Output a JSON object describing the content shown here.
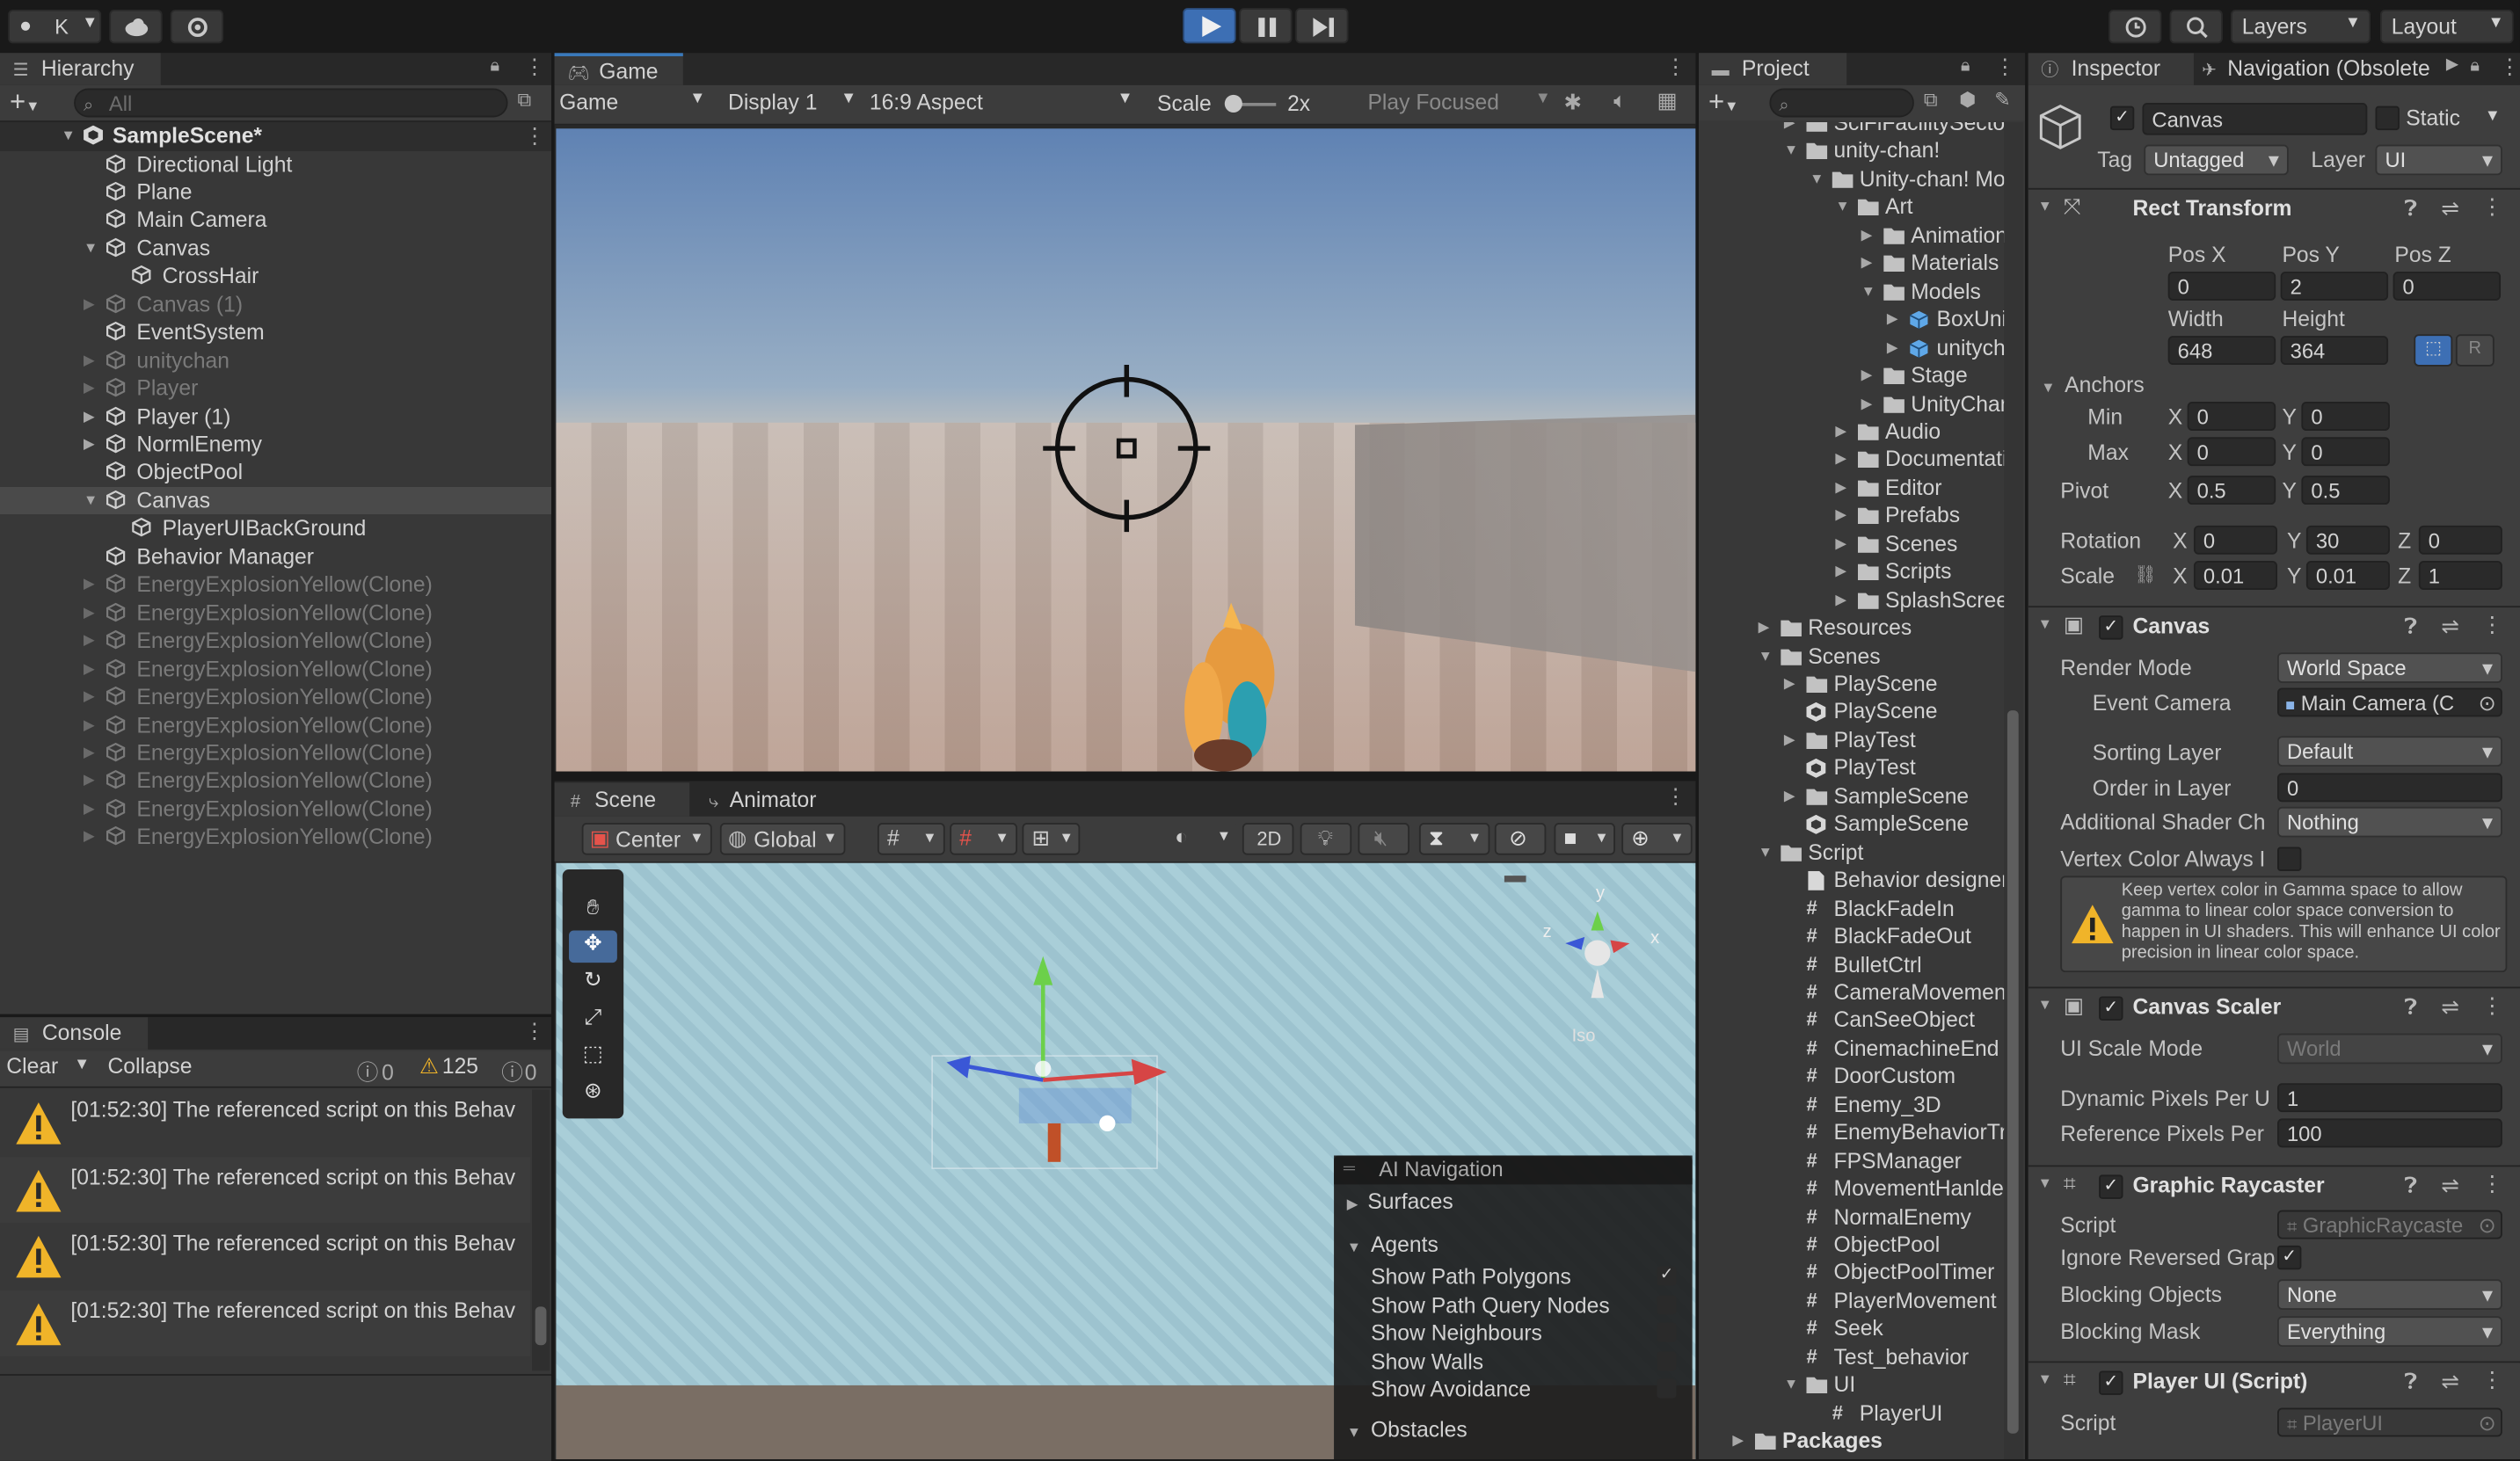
{
  "toolbar": {
    "account": "K",
    "play": "play-icon",
    "pause": "pause-icon",
    "step": "step-icon",
    "layers": "Layers",
    "layout": "Layout"
  },
  "hierarchy": {
    "tab": "Hierarchy",
    "search_placeholder": "All",
    "scene": "SampleScene*",
    "items": [
      {
        "label": "Directional Light",
        "indent": 1,
        "arrow": "",
        "dim": false
      },
      {
        "label": "Plane",
        "indent": 1,
        "arrow": "",
        "dim": false
      },
      {
        "label": "Main Camera",
        "indent": 1,
        "arrow": "",
        "dim": false
      },
      {
        "label": "Canvas",
        "indent": 1,
        "arrow": "▼",
        "dim": false
      },
      {
        "label": "CrossHair",
        "indent": 2,
        "arrow": "",
        "dim": false
      },
      {
        "label": "Canvas (1)",
        "indent": 1,
        "arrow": "▶",
        "dim": true
      },
      {
        "label": "EventSystem",
        "indent": 1,
        "arrow": "",
        "dim": false
      },
      {
        "label": "unitychan",
        "indent": 1,
        "arrow": "▶",
        "dim": true
      },
      {
        "label": "Player",
        "indent": 1,
        "arrow": "▶",
        "dim": true
      },
      {
        "label": "Player (1)",
        "indent": 1,
        "arrow": "▶",
        "dim": false
      },
      {
        "label": "NormlEnemy",
        "indent": 1,
        "arrow": "▶",
        "dim": false
      },
      {
        "label": "ObjectPool",
        "indent": 1,
        "arrow": "",
        "dim": false
      },
      {
        "label": "Canvas",
        "indent": 1,
        "arrow": "▼",
        "dim": false,
        "selected": true
      },
      {
        "label": "PlayerUIBackGround",
        "indent": 2,
        "arrow": "",
        "dim": false
      },
      {
        "label": "Behavior Manager",
        "indent": 1,
        "arrow": "",
        "dim": false
      },
      {
        "label": "EnergyExplosionYellow(Clone)",
        "indent": 1,
        "arrow": "▶",
        "dim": true
      },
      {
        "label": "EnergyExplosionYellow(Clone)",
        "indent": 1,
        "arrow": "▶",
        "dim": true
      },
      {
        "label": "EnergyExplosionYellow(Clone)",
        "indent": 1,
        "arrow": "▶",
        "dim": true
      },
      {
        "label": "EnergyExplosionYellow(Clone)",
        "indent": 1,
        "arrow": "▶",
        "dim": true
      },
      {
        "label": "EnergyExplosionYellow(Clone)",
        "indent": 1,
        "arrow": "▶",
        "dim": true
      },
      {
        "label": "EnergyExplosionYellow(Clone)",
        "indent": 1,
        "arrow": "▶",
        "dim": true
      },
      {
        "label": "EnergyExplosionYellow(Clone)",
        "indent": 1,
        "arrow": "▶",
        "dim": true
      },
      {
        "label": "EnergyExplosionYellow(Clone)",
        "indent": 1,
        "arrow": "▶",
        "dim": true
      },
      {
        "label": "EnergyExplosionYellow(Clone)",
        "indent": 1,
        "arrow": "▶",
        "dim": true
      },
      {
        "label": "EnergyExplosionYellow(Clone)",
        "indent": 1,
        "arrow": "▶",
        "dim": true
      }
    ]
  },
  "console": {
    "tab": "Console",
    "clear": "Clear",
    "collapse": "Collapse",
    "info_count": "0",
    "warn_count": "125",
    "error_count": "0",
    "messages": [
      "[01:52:30] The referenced script on this Behav",
      "[01:52:30] The referenced script on this Behav",
      "[01:52:30] The referenced script on this Behav",
      "[01:52:30] The referenced script on this Behav"
    ]
  },
  "game": {
    "tab": "Game",
    "mode": "Game",
    "display": "Display 1",
    "aspect": "16:9 Aspect",
    "scale_label": "Scale",
    "scale_value": "2x",
    "play_focused": "Play Focused"
  },
  "scene": {
    "tab": "Scene",
    "animator_tab": "Animator",
    "pivot": "Center",
    "space": "Global",
    "mode2d": "2D",
    "gizmo_label": "Iso",
    "gizmo_y": "y",
    "gizmo_x": "x",
    "gizmo_z": "z",
    "nav_overlay": {
      "title": "AI Navigation",
      "surfaces": "Surfaces",
      "agents": "Agents",
      "options": [
        {
          "label": "Show Path Polygons",
          "checked": true
        },
        {
          "label": "Show Path Query Nodes",
          "checked": false
        },
        {
          "label": "Show Neighbours",
          "checked": false
        },
        {
          "label": "Show Walls",
          "checked": false
        },
        {
          "label": "Show Avoidance",
          "checked": false
        }
      ],
      "obstacles": "Obstacles"
    }
  },
  "project": {
    "tab": "Project",
    "items": [
      {
        "label": "SciFiFacilitySector",
        "indent": 2,
        "arrow": "▶",
        "type": "folder"
      },
      {
        "label": "unity-chan!",
        "indent": 2,
        "arrow": "▼",
        "type": "folder"
      },
      {
        "label": "Unity-chan! Mod",
        "indent": 3,
        "arrow": "▼",
        "type": "folder"
      },
      {
        "label": "Art",
        "indent": 4,
        "arrow": "▼",
        "type": "folder"
      },
      {
        "label": "Animations",
        "indent": 5,
        "arrow": "▶",
        "type": "folder"
      },
      {
        "label": "Materials",
        "indent": 5,
        "arrow": "▶",
        "type": "folder"
      },
      {
        "label": "Models",
        "indent": 5,
        "arrow": "▼",
        "type": "folder"
      },
      {
        "label": "BoxUnityc",
        "indent": 6,
        "arrow": "▶",
        "type": "prefab"
      },
      {
        "label": "unitychar",
        "indent": 6,
        "arrow": "▶",
        "type": "prefab"
      },
      {
        "label": "Stage",
        "indent": 5,
        "arrow": "▶",
        "type": "folder"
      },
      {
        "label": "UnityChanS",
        "indent": 5,
        "arrow": "▶",
        "type": "folder"
      },
      {
        "label": "Audio",
        "indent": 4,
        "arrow": "▶",
        "type": "folder"
      },
      {
        "label": "Documentation",
        "indent": 4,
        "arrow": "▶",
        "type": "folder"
      },
      {
        "label": "Editor",
        "indent": 4,
        "arrow": "▶",
        "type": "folder"
      },
      {
        "label": "Prefabs",
        "indent": 4,
        "arrow": "▶",
        "type": "folder"
      },
      {
        "label": "Scenes",
        "indent": 4,
        "arrow": "▶",
        "type": "folder"
      },
      {
        "label": "Scripts",
        "indent": 4,
        "arrow": "▶",
        "type": "folder"
      },
      {
        "label": "SplashScreen",
        "indent": 4,
        "arrow": "▶",
        "type": "folder"
      },
      {
        "label": "Resources",
        "indent": 1,
        "arrow": "▶",
        "type": "folder"
      },
      {
        "label": "Scenes",
        "indent": 1,
        "arrow": "▼",
        "type": "folder"
      },
      {
        "label": "PlayScene",
        "indent": 2,
        "arrow": "▶",
        "type": "folder"
      },
      {
        "label": "PlayScene",
        "indent": 2,
        "arrow": "",
        "type": "scene"
      },
      {
        "label": "PlayTest",
        "indent": 2,
        "arrow": "▶",
        "type": "folder"
      },
      {
        "label": "PlayTest",
        "indent": 2,
        "arrow": "",
        "type": "scene"
      },
      {
        "label": "SampleScene",
        "indent": 2,
        "arrow": "▶",
        "type": "folder"
      },
      {
        "label": "SampleScene",
        "indent": 2,
        "arrow": "",
        "type": "scene"
      },
      {
        "label": "Script",
        "indent": 1,
        "arrow": "▼",
        "type": "folder"
      },
      {
        "label": "Behavior designer c",
        "indent": 2,
        "arrow": "",
        "type": "file"
      },
      {
        "label": "BlackFadeIn",
        "indent": 2,
        "arrow": "",
        "type": "script"
      },
      {
        "label": "BlackFadeOut",
        "indent": 2,
        "arrow": "",
        "type": "script"
      },
      {
        "label": "BulletCtrl",
        "indent": 2,
        "arrow": "",
        "type": "script"
      },
      {
        "label": "CameraMovement",
        "indent": 2,
        "arrow": "",
        "type": "script"
      },
      {
        "label": "CanSeeObject",
        "indent": 2,
        "arrow": "",
        "type": "script"
      },
      {
        "label": "CinemachineEnd",
        "indent": 2,
        "arrow": "",
        "type": "script"
      },
      {
        "label": "DoorCustom",
        "indent": 2,
        "arrow": "",
        "type": "script"
      },
      {
        "label": "Enemy_3D",
        "indent": 2,
        "arrow": "",
        "type": "script"
      },
      {
        "label": "EnemyBehaviorTree",
        "indent": 2,
        "arrow": "",
        "type": "script"
      },
      {
        "label": "FPSManager",
        "indent": 2,
        "arrow": "",
        "type": "script"
      },
      {
        "label": "MovementHanlder",
        "indent": 2,
        "arrow": "",
        "type": "script"
      },
      {
        "label": "NormalEnemy",
        "indent": 2,
        "arrow": "",
        "type": "script"
      },
      {
        "label": "ObjectPool",
        "indent": 2,
        "arrow": "",
        "type": "script"
      },
      {
        "label": "ObjectPoolTimer",
        "indent": 2,
        "arrow": "",
        "type": "script"
      },
      {
        "label": "PlayerMovement",
        "indent": 2,
        "arrow": "",
        "type": "script"
      },
      {
        "label": "Seek",
        "indent": 2,
        "arrow": "",
        "type": "script"
      },
      {
        "label": "Test_behavior",
        "indent": 2,
        "arrow": "",
        "type": "script"
      },
      {
        "label": "UI",
        "indent": 2,
        "arrow": "▼",
        "type": "folder"
      },
      {
        "label": "PlayerUI",
        "indent": 3,
        "arrow": "",
        "type": "script"
      },
      {
        "label": "Packages",
        "indent": 0,
        "arrow": "▶",
        "type": "folder"
      }
    ]
  },
  "inspector": {
    "tab": "Inspector",
    "nav_tab": "Navigation (Obsolete",
    "object_name": "Canvas",
    "static_label": "Static",
    "tag_label": "Tag",
    "tag_value": "Untagged",
    "layer_label": "Layer",
    "layer_value": "UI",
    "rect": {
      "title": "Rect Transform",
      "posx_l": "Pos X",
      "posy_l": "Pos Y",
      "posz_l": "Pos Z",
      "posx": "0",
      "posy": "2",
      "posz": "0",
      "width_l": "Width",
      "height_l": "Height",
      "width": "648",
      "height": "364",
      "r": "R",
      "anchors": "Anchors",
      "min": "Min",
      "max": "Max",
      "pivot": "Pivot",
      "x": "X",
      "y": "Y",
      "z": "Z",
      "min_x": "0",
      "min_y": "0",
      "max_x": "0",
      "max_y": "0",
      "pivot_x": "0.5",
      "pivot_y": "0.5",
      "rotation": "Rotation",
      "rot_x": "0",
      "rot_y": "30",
      "rot_z": "0",
      "scale": "Scale",
      "scale_x": "0.01",
      "scale_y": "0.01",
      "scale_z": "1"
    },
    "canvas": {
      "title": "Canvas",
      "render_mode_l": "Render Mode",
      "render_mode": "World Space",
      "event_camera_l": "Event Camera",
      "event_camera": "Main Camera (C",
      "sorting_layer_l": "Sorting Layer",
      "sorting_layer": "Default",
      "order_l": "Order in Layer",
      "order": "0",
      "shader_l": "Additional Shader Ch",
      "shader": "Nothing",
      "vertex_l": "Vertex Color Always I",
      "warning": "Keep vertex color in Gamma space to allow gamma to linear color space conversion to happen in UI shaders. This will enhance UI color precision in linear color space."
    },
    "scaler": {
      "title": "Canvas Scaler",
      "mode_l": "UI Scale Mode",
      "mode": "World",
      "dyn_l": "Dynamic Pixels Per U",
      "dyn": "1",
      "ref_l": "Reference Pixels Per",
      "ref": "100"
    },
    "raycaster": {
      "title": "Graphic Raycaster",
      "script_l": "Script",
      "script": "GraphicRaycaste",
      "ignore_l": "Ignore Reversed Grap",
      "blocking_l": "Blocking Objects",
      "blocking": "None",
      "mask_l": "Blocking Mask",
      "mask": "Everything"
    },
    "playerui": {
      "title": "Player UI (Script)",
      "script_l": "Script",
      "script": "PlayerUI"
    }
  }
}
